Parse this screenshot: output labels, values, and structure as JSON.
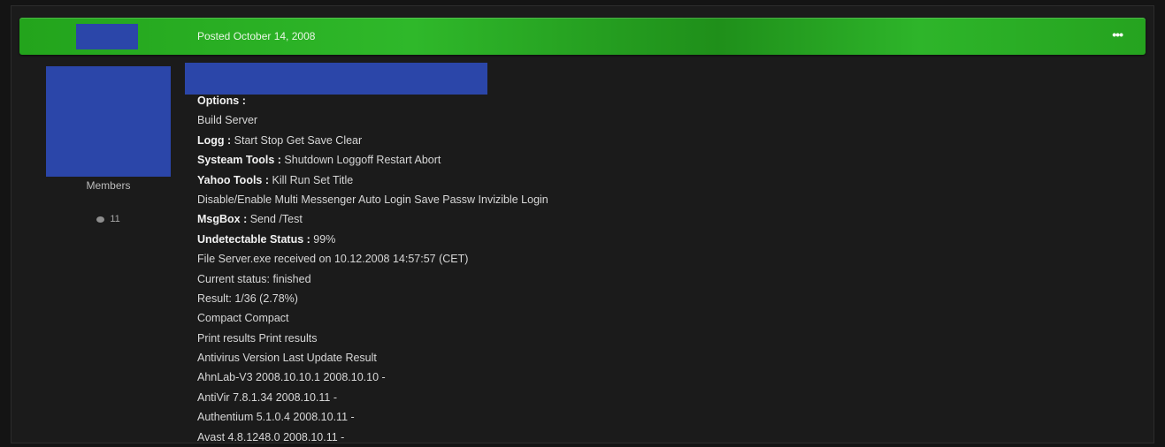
{
  "post": {
    "date": "Posted October 14, 2008",
    "more_label": "•••"
  },
  "author": {
    "group": "Members",
    "post_count": "11"
  },
  "content": {
    "options": {
      "label": "Options :",
      "value": ""
    },
    "build_server": "Build Server",
    "logg": {
      "label": "Logg :",
      "value": " Start Stop Get Save Clear"
    },
    "systeam": {
      "label": "Systeam Tools :",
      "value": " Shutdown Loggoff Restart Abort"
    },
    "yahoo": {
      "label": "Yahoo Tools :",
      "value": " Kill Run Set Title"
    },
    "disable_enable": "Disable/Enable Multi Messenger Auto Login Save Passw Invizible Login",
    "msgbox": {
      "label": "MsgBox :",
      "value": " Send /Test"
    },
    "undetectable": {
      "label": "Undetectable Status :",
      "value": " 99%"
    },
    "file_received": "File Server.exe received on 10.12.2008 14:57:57 (CET)",
    "current_status": "Current status: finished",
    "result": "Result: 1/36 (2.78%)",
    "compact": "Compact Compact",
    "print_results": "Print results Print results",
    "av_header": "Antivirus Version Last Update Result",
    "av_rows": [
      "AhnLab-V3 2008.10.10.1 2008.10.10 -",
      "AntiVir 7.8.1.34 2008.10.11 -",
      "Authentium 5.1.0.4 2008.10.11 -",
      "Avast 4.8.1248.0 2008.10.11 -"
    ]
  }
}
